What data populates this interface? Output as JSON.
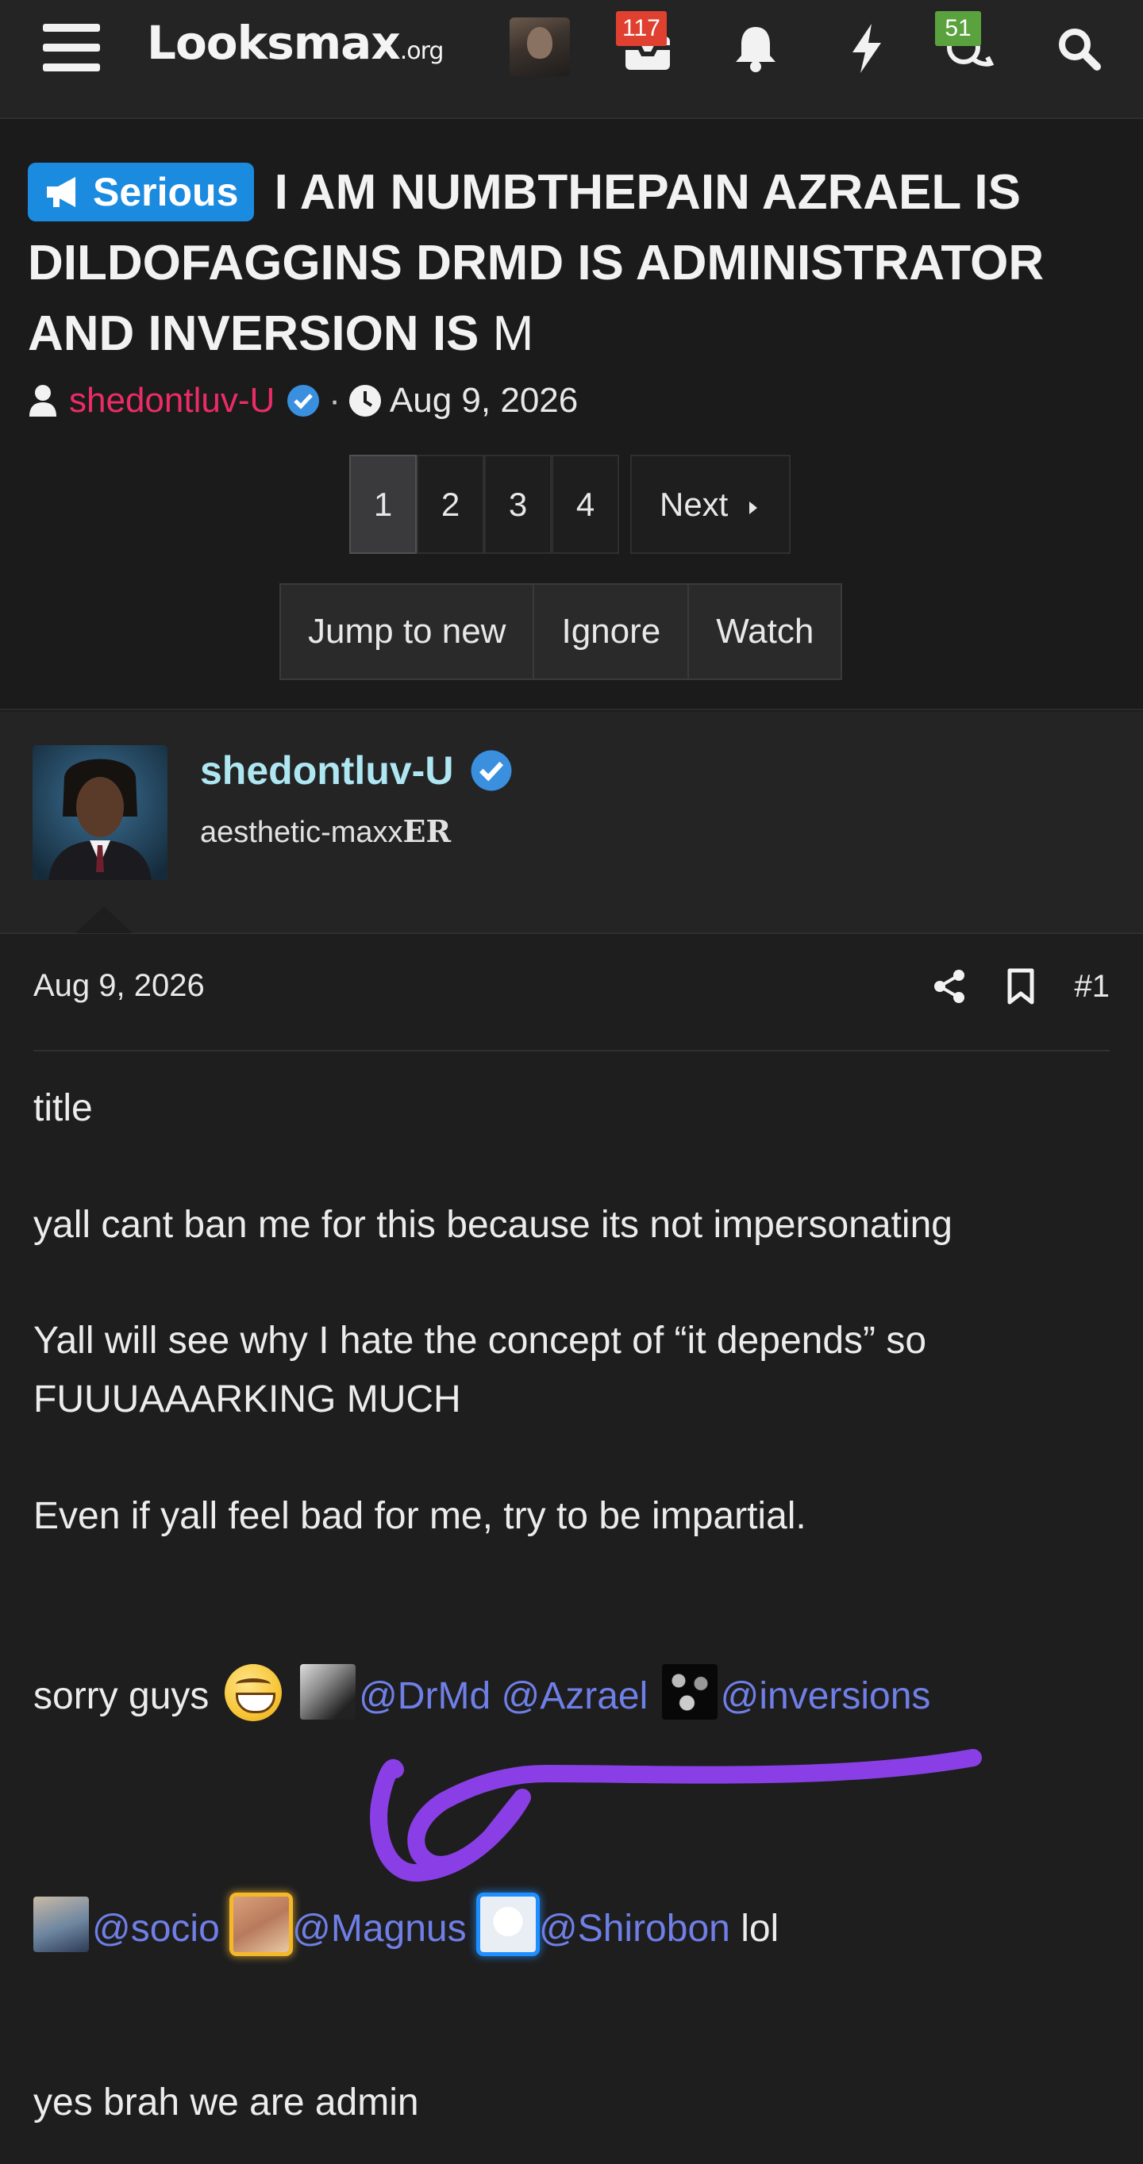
{
  "nav": {
    "logo_main": "Looksmax",
    "logo_tld": ".org",
    "inbox_badge": "117",
    "conversations_badge": "51",
    "badge_colors": {
      "inbox": "#e0402f",
      "conversations": "#5aa23d"
    }
  },
  "thread": {
    "prefix_label": "Serious",
    "prefix_color": "#1b8be0",
    "title": "I AM NUMBTHEPAIN AZRAEL IS DILDOFAGGINS DRMD IS ADMINISTRATOR AND INVERSION IS",
    "title_end": "M",
    "author": "shedontluv-U",
    "author_color": "#ec2c66",
    "separator": "·",
    "date": "Aug 9, 2026",
    "pages": [
      "1",
      "2",
      "3",
      "4"
    ],
    "current_page": "1",
    "next_label": "Next",
    "actions": [
      "Jump to new",
      "Ignore",
      "Watch"
    ]
  },
  "post": {
    "username": "shedontluv-U",
    "user_title_main": "aesthetic-maxx",
    "user_title_suffix": "ER",
    "date": "Aug 9, 2026",
    "number": "#1",
    "lines": {
      "l1": "title",
      "l2": "yall cant ban me for this because its not impersonating",
      "l3": "Yall will see why I hate the concept of “it depends” so",
      "l4": "FUUUAAARKING MUCH",
      "l5": "Even if yall feel bad for me, try to be impartial.",
      "l6_text": "sorry guys",
      "mention_drmd": "@DrMd",
      "mention_azrael": "@Azrael",
      "mention_inversions": "@inversions",
      "mention_socio": "@socio",
      "mention_magnus": "@Magnus",
      "mention_shirobon": "@Shirobon",
      "l7_tail": "lol",
      "l8": "yes brah we are admin"
    },
    "scribble_color": "#8a3fe6"
  }
}
